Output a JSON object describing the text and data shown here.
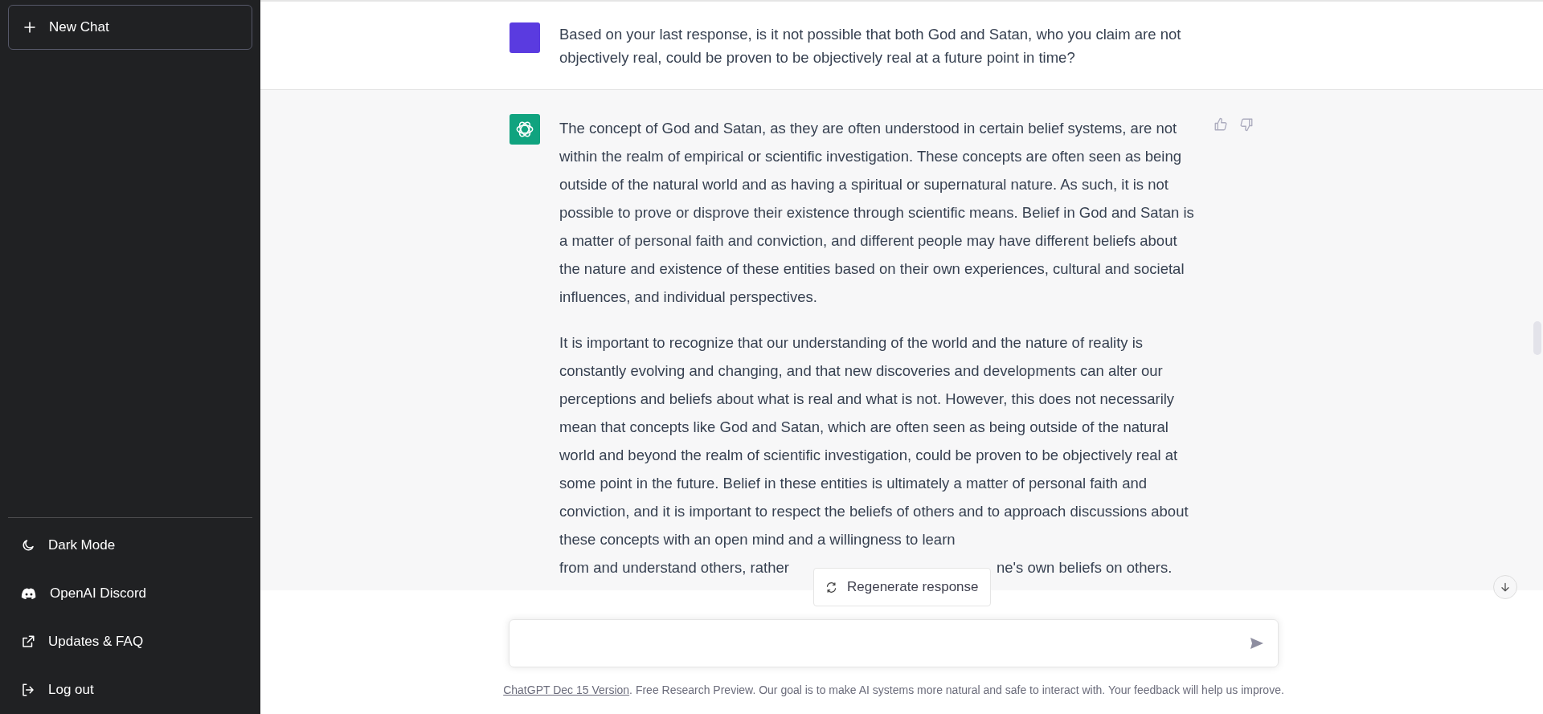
{
  "sidebar": {
    "new_chat": {
      "label": "New Chat"
    },
    "items": [
      {
        "kind": "theme",
        "label": "Dark Mode"
      },
      {
        "kind": "discord",
        "label": "OpenAI Discord"
      },
      {
        "kind": "external",
        "label": "Updates & FAQ"
      },
      {
        "kind": "logout",
        "label": "Log out"
      }
    ]
  },
  "conversation": [
    {
      "kind": "user",
      "paragraphs": [
        "Based on your last response, is it not possible that both God and Satan, who you claim are not objectively real, could be proven to be objectively real at a future point in time?"
      ]
    },
    {
      "kind": "assistant",
      "paragraphs": [
        "The concept of God and Satan, as they are often understood in certain belief systems, are not within the realm of empirical or scientific investigation. These concepts are often seen as being outside of the natural world and as having a spiritual or supernatural nature. As such, it is not possible to prove or disprove their existence through scientific means. Belief in God and Satan is a matter of personal faith and conviction, and different people may have different beliefs about the nature and existence of these entities based on their own experiences, cultural and societal influences, and individual perspectives.",
        "It is important to recognize that our understanding of the world and the nature of reality is constantly evolving and changing, and that new discoveries and developments can alter our perceptions and beliefs about what is real and what is not. However, this does not necessarily mean that concepts like God and Satan, which are often seen as being outside of the natural world and beyond the realm of scientific investigation, could be proven to be objectively real at some point in the future. Belief in these entities is ultimately a matter of personal faith and conviction, and it is important to respect the beliefs of others and to approach discussions about these concepts with an open mind and a willingness to learn"
      ],
      "last_line": [
        "from and understand others, rather",
        "ne's own beliefs on others."
      ]
    }
  ],
  "regenerate": {
    "label": "Regenerate response"
  },
  "footer": {
    "link": "ChatGPT Dec 15 Version",
    "text": ". Free Research Preview. Our goal is to make AI systems more natural and safe to interact with. Your feedback will help us improve."
  }
}
